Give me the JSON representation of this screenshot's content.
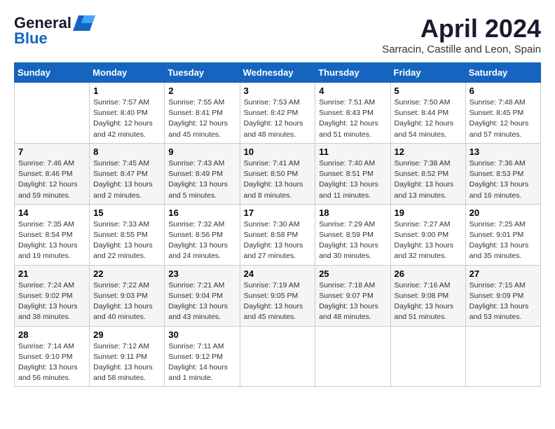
{
  "header": {
    "logo_line1": "General",
    "logo_line2": "Blue",
    "title": "April 2024",
    "subtitle": "Sarracin, Castille and Leon, Spain"
  },
  "calendar": {
    "days_of_week": [
      "Sunday",
      "Monday",
      "Tuesday",
      "Wednesday",
      "Thursday",
      "Friday",
      "Saturday"
    ],
    "weeks": [
      [
        {
          "day": "",
          "info": ""
        },
        {
          "day": "1",
          "info": "Sunrise: 7:57 AM\nSunset: 8:40 PM\nDaylight: 12 hours\nand 42 minutes."
        },
        {
          "day": "2",
          "info": "Sunrise: 7:55 AM\nSunset: 8:41 PM\nDaylight: 12 hours\nand 45 minutes."
        },
        {
          "day": "3",
          "info": "Sunrise: 7:53 AM\nSunset: 8:42 PM\nDaylight: 12 hours\nand 48 minutes."
        },
        {
          "day": "4",
          "info": "Sunrise: 7:51 AM\nSunset: 8:43 PM\nDaylight: 12 hours\nand 51 minutes."
        },
        {
          "day": "5",
          "info": "Sunrise: 7:50 AM\nSunset: 8:44 PM\nDaylight: 12 hours\nand 54 minutes."
        },
        {
          "day": "6",
          "info": "Sunrise: 7:48 AM\nSunset: 8:45 PM\nDaylight: 12 hours\nand 57 minutes."
        }
      ],
      [
        {
          "day": "7",
          "info": "Sunrise: 7:46 AM\nSunset: 8:46 PM\nDaylight: 12 hours\nand 59 minutes."
        },
        {
          "day": "8",
          "info": "Sunrise: 7:45 AM\nSunset: 8:47 PM\nDaylight: 13 hours\nand 2 minutes."
        },
        {
          "day": "9",
          "info": "Sunrise: 7:43 AM\nSunset: 8:49 PM\nDaylight: 13 hours\nand 5 minutes."
        },
        {
          "day": "10",
          "info": "Sunrise: 7:41 AM\nSunset: 8:50 PM\nDaylight: 13 hours\nand 8 minutes."
        },
        {
          "day": "11",
          "info": "Sunrise: 7:40 AM\nSunset: 8:51 PM\nDaylight: 13 hours\nand 11 minutes."
        },
        {
          "day": "12",
          "info": "Sunrise: 7:38 AM\nSunset: 8:52 PM\nDaylight: 13 hours\nand 13 minutes."
        },
        {
          "day": "13",
          "info": "Sunrise: 7:36 AM\nSunset: 8:53 PM\nDaylight: 13 hours\nand 16 minutes."
        }
      ],
      [
        {
          "day": "14",
          "info": "Sunrise: 7:35 AM\nSunset: 8:54 PM\nDaylight: 13 hours\nand 19 minutes."
        },
        {
          "day": "15",
          "info": "Sunrise: 7:33 AM\nSunset: 8:55 PM\nDaylight: 13 hours\nand 22 minutes."
        },
        {
          "day": "16",
          "info": "Sunrise: 7:32 AM\nSunset: 8:56 PM\nDaylight: 13 hours\nand 24 minutes."
        },
        {
          "day": "17",
          "info": "Sunrise: 7:30 AM\nSunset: 8:58 PM\nDaylight: 13 hours\nand 27 minutes."
        },
        {
          "day": "18",
          "info": "Sunrise: 7:29 AM\nSunset: 8:59 PM\nDaylight: 13 hours\nand 30 minutes."
        },
        {
          "day": "19",
          "info": "Sunrise: 7:27 AM\nSunset: 9:00 PM\nDaylight: 13 hours\nand 32 minutes."
        },
        {
          "day": "20",
          "info": "Sunrise: 7:25 AM\nSunset: 9:01 PM\nDaylight: 13 hours\nand 35 minutes."
        }
      ],
      [
        {
          "day": "21",
          "info": "Sunrise: 7:24 AM\nSunset: 9:02 PM\nDaylight: 13 hours\nand 38 minutes."
        },
        {
          "day": "22",
          "info": "Sunrise: 7:22 AM\nSunset: 9:03 PM\nDaylight: 13 hours\nand 40 minutes."
        },
        {
          "day": "23",
          "info": "Sunrise: 7:21 AM\nSunset: 9:04 PM\nDaylight: 13 hours\nand 43 minutes."
        },
        {
          "day": "24",
          "info": "Sunrise: 7:19 AM\nSunset: 9:05 PM\nDaylight: 13 hours\nand 45 minutes."
        },
        {
          "day": "25",
          "info": "Sunrise: 7:18 AM\nSunset: 9:07 PM\nDaylight: 13 hours\nand 48 minutes."
        },
        {
          "day": "26",
          "info": "Sunrise: 7:16 AM\nSunset: 9:08 PM\nDaylight: 13 hours\nand 51 minutes."
        },
        {
          "day": "27",
          "info": "Sunrise: 7:15 AM\nSunset: 9:09 PM\nDaylight: 13 hours\nand 53 minutes."
        }
      ],
      [
        {
          "day": "28",
          "info": "Sunrise: 7:14 AM\nSunset: 9:10 PM\nDaylight: 13 hours\nand 56 minutes."
        },
        {
          "day": "29",
          "info": "Sunrise: 7:12 AM\nSunset: 9:11 PM\nDaylight: 13 hours\nand 58 minutes."
        },
        {
          "day": "30",
          "info": "Sunrise: 7:11 AM\nSunset: 9:12 PM\nDaylight: 14 hours\nand 1 minute."
        },
        {
          "day": "",
          "info": ""
        },
        {
          "day": "",
          "info": ""
        },
        {
          "day": "",
          "info": ""
        },
        {
          "day": "",
          "info": ""
        }
      ]
    ]
  }
}
